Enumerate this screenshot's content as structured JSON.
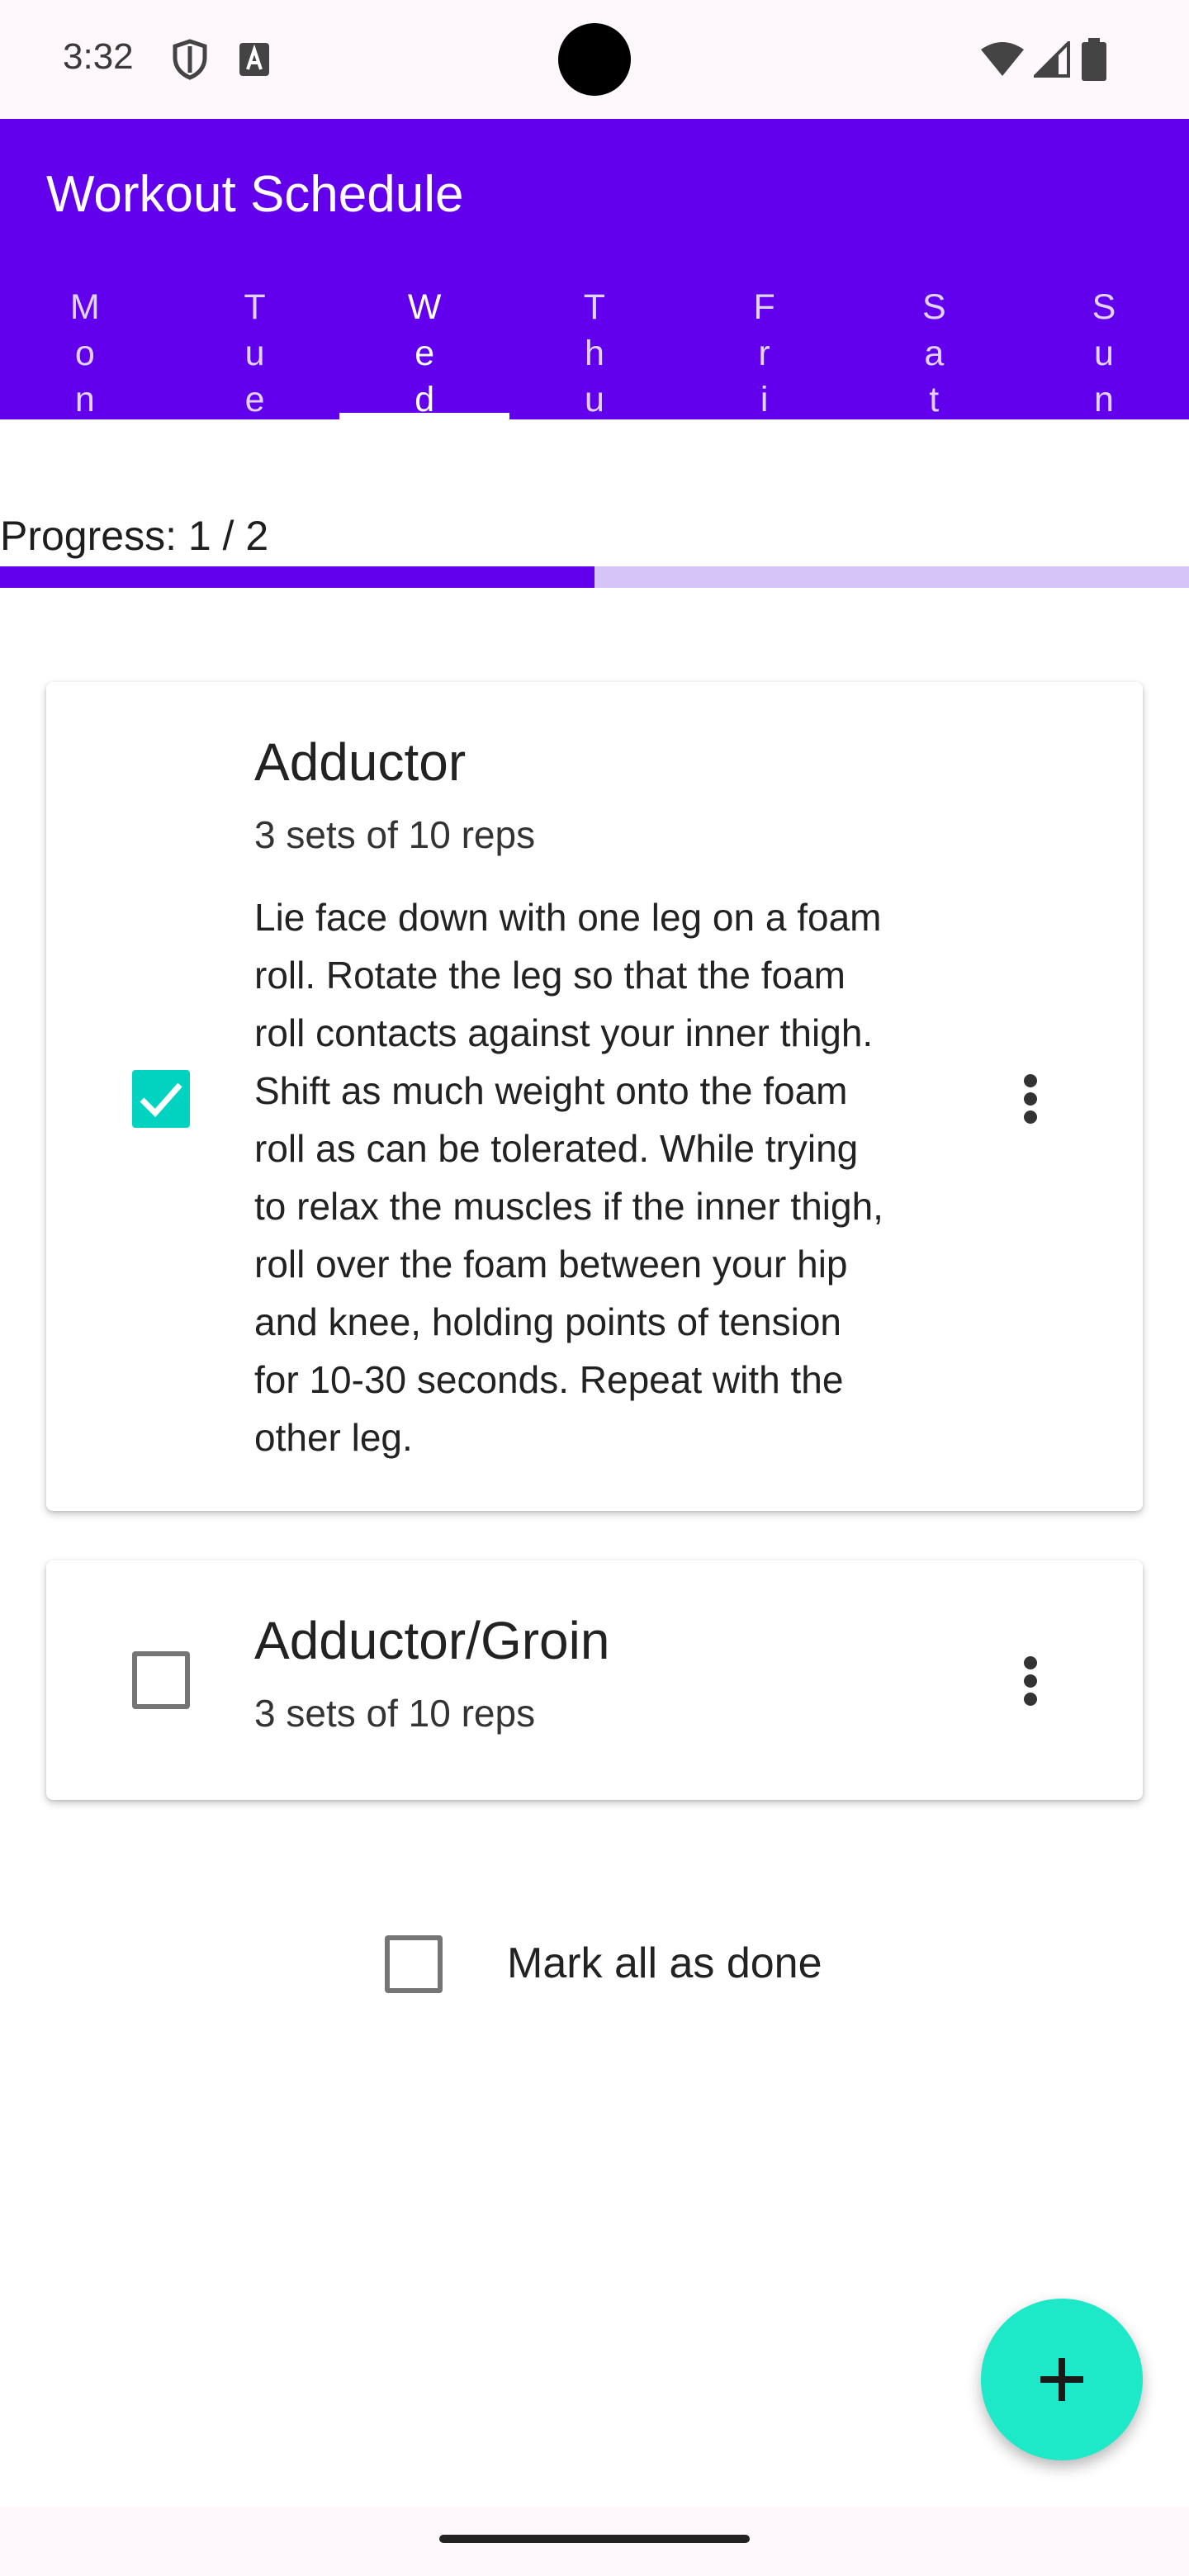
{
  "status_bar": {
    "time": "3:32",
    "icons": [
      "shield-icon",
      "font-a-icon",
      "wifi-icon",
      "signal-icon",
      "battery-icon"
    ]
  },
  "app_bar": {
    "title": "Workout Schedule",
    "color": "#6200EE"
  },
  "tabs": [
    {
      "label": "Mon",
      "chars": [
        "M",
        "o",
        "n"
      ],
      "active": false
    },
    {
      "label": "Tue",
      "chars": [
        "T",
        "u",
        "e"
      ],
      "active": false
    },
    {
      "label": "Wed",
      "chars": [
        "W",
        "e",
        "d"
      ],
      "active": true
    },
    {
      "label": "Thu",
      "chars": [
        "T",
        "h",
        "u"
      ],
      "active": false
    },
    {
      "label": "Fri",
      "chars": [
        "F",
        "r",
        "i"
      ],
      "active": false
    },
    {
      "label": "Sat",
      "chars": [
        "S",
        "a",
        "t"
      ],
      "active": false
    },
    {
      "label": "Sun",
      "chars": [
        "S",
        "u",
        "n"
      ],
      "active": false
    }
  ],
  "progress": {
    "label": "Progress: 1 / 2",
    "fraction": 0.5
  },
  "exercises": [
    {
      "title": "Adductor",
      "sets": "3 sets of 10 reps",
      "checked": true,
      "description": [
        "Lie face down with one leg on a foam",
        "roll. Rotate the leg so that the foam",
        "roll contacts against your inner thigh.",
        "Shift as much weight onto the foam",
        "roll as can be tolerated. While trying",
        "to relax the muscles if the inner thigh,",
        "roll over the foam between your hip",
        "and knee, holding points of tension",
        "for 10-30 seconds. Repeat with the",
        "other leg."
      ]
    },
    {
      "title": "Adductor/Groin",
      "sets": "3 sets of 10 reps",
      "checked": false
    }
  ],
  "mark_all": {
    "label": "Mark all as done",
    "checked": false
  },
  "fab": {
    "icon": "plus-icon",
    "color": "#1DE9C8"
  },
  "accent_checkbox_color": "#00D4C1"
}
